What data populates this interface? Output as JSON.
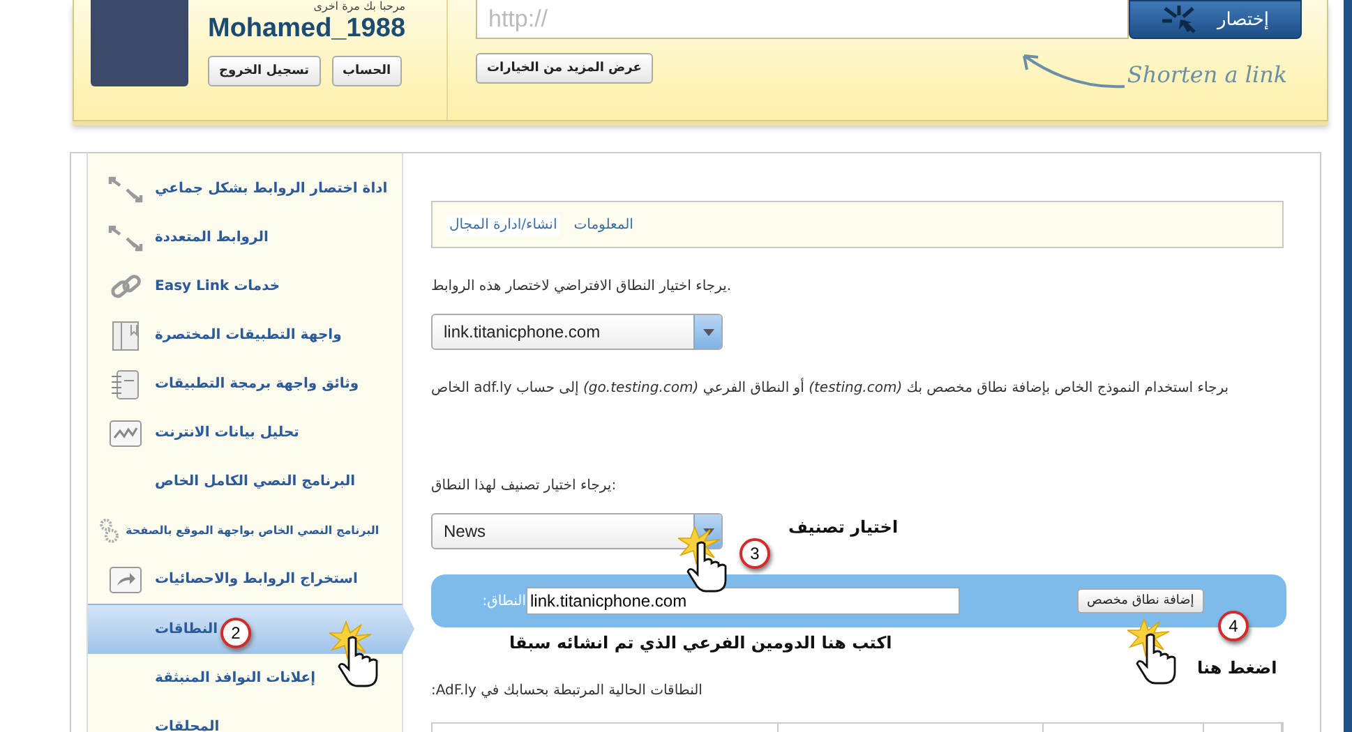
{
  "user": {
    "greeting": "مرحبا بك مرة اخرى",
    "username": "Mohamed_1988",
    "buttons": [
      "الحساب",
      "تسجيل الخروج"
    ]
  },
  "shortener": {
    "placeholder": "http://",
    "submit": "إختصار",
    "more_options": "عرض المزيد من الخيارات",
    "hint": "Shorten a link"
  },
  "sidebar": {
    "items": [
      {
        "label": "اداة اختصار الروابط بشكل جماعي",
        "selected": false
      },
      {
        "label": "الروابط المتعددة",
        "selected": false
      },
      {
        "label": "خدمات Easy Link",
        "selected": false
      },
      {
        "label": "واجهة التطبيقات المختصرة",
        "selected": false
      },
      {
        "label": "وثائق واجهة برمجة التطبيقات",
        "selected": false
      },
      {
        "label": "تحليل بيانات الانترنت",
        "selected": false
      },
      {
        "label": "البرنامج النصي الكامل الخاص",
        "selected": false
      },
      {
        "label": "البرنامج النصي الخاص بواجهة الموقع بالصفحة",
        "selected": false
      },
      {
        "label": "استخراج الروابط والاحصائيات",
        "selected": false
      },
      {
        "label": "النطاقات",
        "selected": true
      },
      {
        "label": "إعلانات النوافذ المنبثقة",
        "selected": false
      },
      {
        "label": "المحلقات",
        "selected": false
      }
    ]
  },
  "tabs": [
    {
      "label": "المعلومات",
      "selected": false
    },
    {
      "label": "انشاء/ادارة المجال",
      "selected": true
    }
  ],
  "content": {
    "default_prompt": "يرجاء اختيار النطاق الافتراضي لاختصار هذه الروابط.",
    "default_domain": "link.titanicphone.com",
    "info": "الخاص adf.ly إلى حساب *(go.testing.com)* أو النطاق الفرعي *(testing.com)* برجاء استخدام النموذج الخاص بإضافة نطاق مخصص بك",
    "category_prompt": "يرجاء اختيار تصنيف لهذا النطاق:",
    "category": "News",
    "domain_label": "النطاق:",
    "domain_value": "link.titanicphone.com",
    "add_button": "إضافة نطاق مخصص",
    "current_domains": "النطاقات الحالية المرتبطة بحسابك في AdF.ly:"
  },
  "annotations": {
    "step_sidebar": "2",
    "step_category": "3",
    "category_note": "اختيار تصنيف",
    "step_add": "4",
    "domain_note": "اكتب هنا الدومين الفرعي الذي تم انشائه سبقا",
    "add_note": "اضغط هنا"
  }
}
